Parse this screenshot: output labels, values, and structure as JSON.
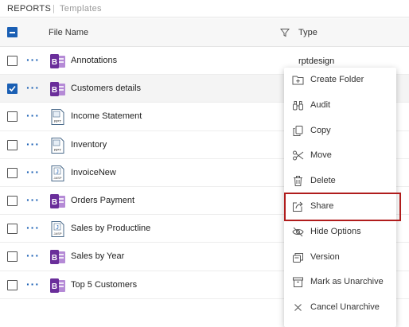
{
  "breadcrumb": {
    "reports": "REPORTS",
    "separator": "|",
    "templates": "Templates"
  },
  "table": {
    "columns": {
      "name": "File Name",
      "type": "Type"
    },
    "rows": [
      {
        "name": "Annotations",
        "type": "rptdesign",
        "icon": "report-designer-icon",
        "checked": false
      },
      {
        "name": "Customers details",
        "type": "",
        "icon": "report-designer-icon",
        "checked": true
      },
      {
        "name": "Income Statement",
        "type": "",
        "icon": "rpt-file-icon",
        "checked": false
      },
      {
        "name": "Inventory",
        "type": "",
        "icon": "rpt-file-icon",
        "checked": false
      },
      {
        "name": "InvoiceNew",
        "type": "",
        "icon": "jasper-file-icon",
        "checked": false
      },
      {
        "name": "Orders Payment",
        "type": "",
        "icon": "report-designer-icon",
        "checked": false
      },
      {
        "name": "Sales by Productline",
        "type": "",
        "icon": "jasper-file-icon",
        "checked": false
      },
      {
        "name": "Sales by Year",
        "type": "",
        "icon": "report-designer-icon",
        "checked": false
      },
      {
        "name": "Top 5 Customers",
        "type": "",
        "icon": "report-designer-icon",
        "checked": false
      }
    ],
    "row_menu_glyph": "···",
    "rpt_icon_text": "RPT",
    "jasper_icon_text": "J",
    "jasper_icon_sub": "JASP"
  },
  "context_menu": {
    "items": [
      {
        "label": "Create Folder",
        "icon": "folder-plus-icon"
      },
      {
        "label": "Audit",
        "icon": "binoculars-icon"
      },
      {
        "label": "Copy",
        "icon": "copy-icon"
      },
      {
        "label": "Move",
        "icon": "scissors-icon"
      },
      {
        "label": "Delete",
        "icon": "trash-icon"
      },
      {
        "label": "Share",
        "icon": "share-icon",
        "highlighted": true
      },
      {
        "label": "Hide Options",
        "icon": "eye-slash-icon"
      },
      {
        "label": "Version",
        "icon": "version-icon"
      },
      {
        "label": "Mark as Unarchive",
        "icon": "archive-icon"
      },
      {
        "label": "Cancel Unarchive",
        "icon": "close-icon"
      }
    ]
  },
  "colors": {
    "accent": "#1a5fb4",
    "report_icon": "#6a2e9a",
    "highlight_border": "#b01c1c"
  }
}
